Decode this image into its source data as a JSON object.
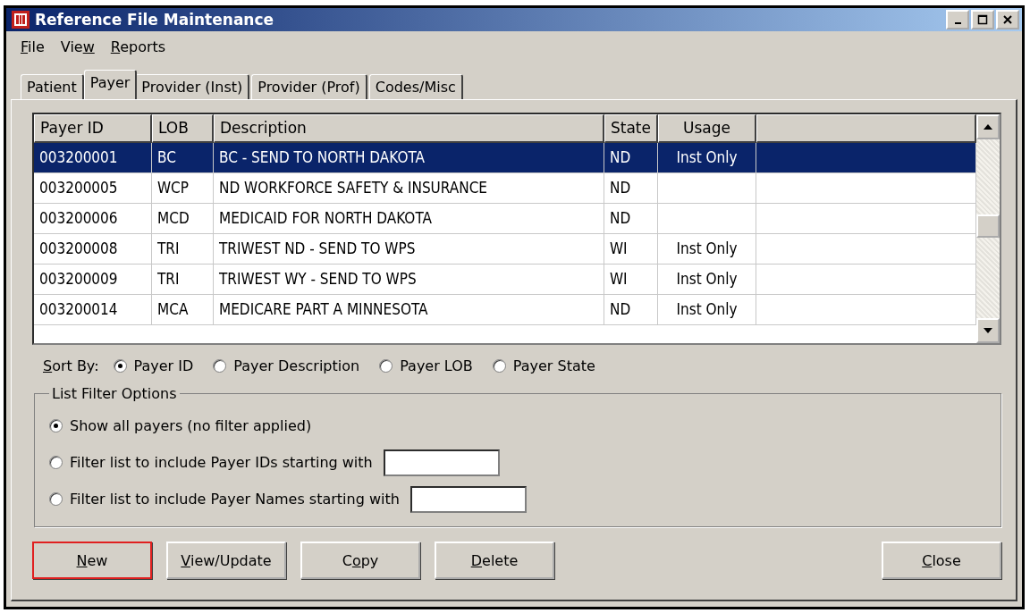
{
  "window": {
    "title": "Reference File Maintenance"
  },
  "menu": [
    {
      "label_parts": [
        {
          "text": "F",
          "underlined": true
        },
        {
          "text": "ile",
          "underlined": false
        }
      ]
    },
    {
      "label_parts": [
        {
          "text": "Vie",
          "underlined": false
        },
        {
          "text": "w",
          "underlined": true
        }
      ]
    },
    {
      "label_parts": [
        {
          "text": "R",
          "underlined": true
        },
        {
          "text": "eports",
          "underlined": false
        }
      ]
    }
  ],
  "tabs": [
    {
      "label": "Patient",
      "selected": false
    },
    {
      "label": "Payer",
      "selected": true
    },
    {
      "label": "Provider (Inst)",
      "selected": false
    },
    {
      "label": "Provider (Prof)",
      "selected": false
    },
    {
      "label": "Codes/Misc",
      "selected": false
    }
  ],
  "table": {
    "columns": [
      "Payer ID",
      "LOB",
      "Description",
      "State",
      "Usage"
    ],
    "rows": [
      {
        "cells": [
          "003200001",
          "BC",
          "BC - SEND TO NORTH DAKOTA",
          "ND",
          "Inst Only"
        ],
        "selected": true
      },
      {
        "cells": [
          "003200005",
          "WCP",
          "ND WORKFORCE SAFETY & INSURANCE",
          "ND",
          ""
        ],
        "selected": false
      },
      {
        "cells": [
          "003200006",
          "MCD",
          "MEDICAID FOR NORTH DAKOTA",
          "ND",
          ""
        ],
        "selected": false
      },
      {
        "cells": [
          "003200008",
          "TRI",
          "TRIWEST ND - SEND TO WPS",
          "WI",
          "Inst Only"
        ],
        "selected": false
      },
      {
        "cells": [
          "003200009",
          "TRI",
          "TRIWEST WY - SEND TO WPS",
          "WI",
          "Inst Only"
        ],
        "selected": false
      },
      {
        "cells": [
          "003200014",
          "MCA",
          "MEDICARE PART A MINNESOTA",
          "ND",
          "Inst Only"
        ],
        "selected": false
      }
    ]
  },
  "sort_by": {
    "label_parts": [
      {
        "text": "S",
        "underlined": true
      },
      {
        "text": "ort By:",
        "underlined": false
      }
    ],
    "options": [
      {
        "label": "Payer ID",
        "selected": true
      },
      {
        "label": "Payer Description",
        "selected": false
      },
      {
        "label": "Payer LOB",
        "selected": false
      },
      {
        "label": "Payer State",
        "selected": false
      }
    ]
  },
  "filter": {
    "title": "List Filter Options",
    "options": [
      {
        "label": "Show all payers (no filter applied)",
        "selected": true,
        "kind": "plain"
      },
      {
        "label": "Filter list to include Payer IDs starting with",
        "selected": false,
        "kind": "input"
      },
      {
        "label": "Filter list to include Payer Names starting with",
        "selected": false,
        "kind": "input"
      }
    ]
  },
  "buttons": [
    {
      "label_parts": [
        {
          "text": "N",
          "underlined": true
        },
        {
          "text": "ew",
          "underlined": false
        }
      ],
      "highlighted": true
    },
    {
      "label_parts": [
        {
          "text": "V",
          "underlined": true
        },
        {
          "text": "iew/Update",
          "underlined": false
        }
      ],
      "highlighted": false
    },
    {
      "label_parts": [
        {
          "text": "C",
          "underlined": false
        },
        {
          "text": "o",
          "underlined": true
        },
        {
          "text": "py",
          "underlined": false
        }
      ],
      "highlighted": false
    },
    {
      "label_parts": [
        {
          "text": "D",
          "underlined": true
        },
        {
          "text": "elete",
          "underlined": false
        }
      ],
      "highlighted": false
    }
  ],
  "close_button": {
    "label_parts": [
      {
        "text": "C",
        "underlined": true
      },
      {
        "text": "lose",
        "underlined": false
      }
    ]
  }
}
